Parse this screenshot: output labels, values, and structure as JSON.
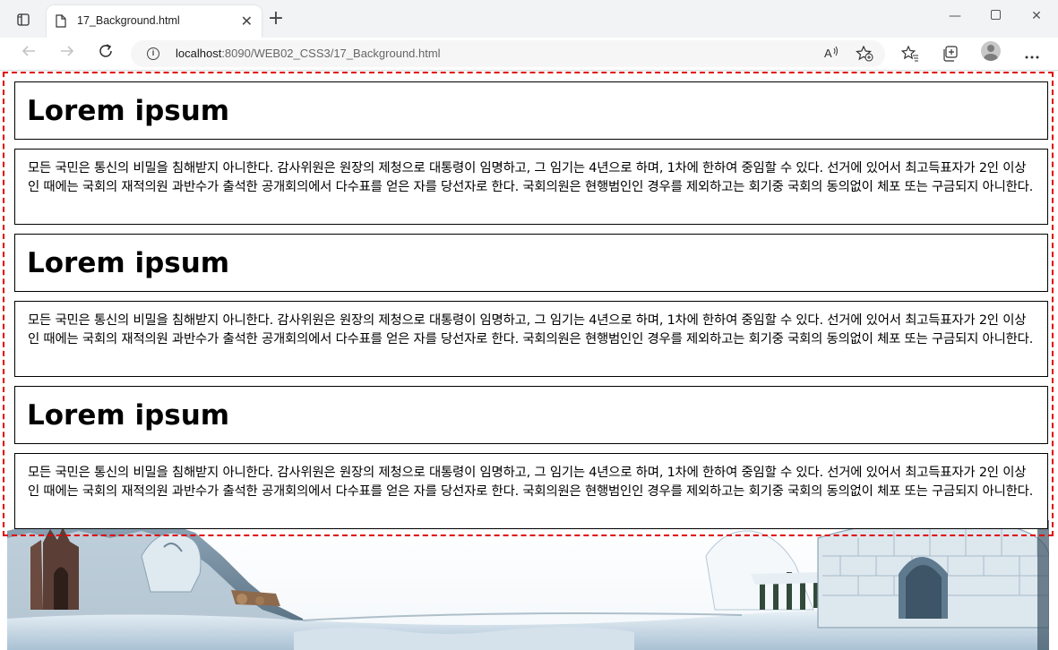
{
  "browser": {
    "tab_title": "17_Background.html",
    "url_host": "localhost",
    "url_rest": ":8090/WEB02_CSS3/17_Background.html"
  },
  "page": {
    "sections": [
      {
        "heading": "Lorem ipsum",
        "text": "모든 국민은 통신의 비밀을 침해받지 아니한다. 감사위원은 원장의 제청으로 대통령이 임명하고, 그 임기는 4년으로 하며, 1차에 한하여 중임할 수 있다. 선거에 있어서 최고득표자가 2인 이상인 때에는 국회의 재적의원 과반수가 출석한 공개회의에서 다수표를 얻은 자를 당선자로 한다. 국회의원은 현행범인인 경우를 제외하고는 회기중 국회의 동의없이 체포 또는 구금되지 아니한다."
      },
      {
        "heading": "Lorem ipsum",
        "text": "모든 국민은 통신의 비밀을 침해받지 아니한다. 감사위원은 원장의 제청으로 대통령이 임명하고, 그 임기는 4년으로 하며, 1차에 한하여 중임할 수 있다. 선거에 있어서 최고득표자가 2인 이상인 때에는 국회의 재적의원 과반수가 출석한 공개회의에서 다수표를 얻은 자를 당선자로 한다. 국회의원은 현행범인인 경우를 제외하고는 회기중 국회의 동의없이 체포 또는 구금되지 아니한다."
      },
      {
        "heading": "Lorem ipsum",
        "text": "모든 국민은 통신의 비밀을 침해받지 아니한다. 감사위원은 원장의 제청으로 대통령이 임명하고, 그 임기는 4년으로 하며, 1차에 한하여 중임할 수 있다. 선거에 있어서 최고득표자가 2인 이상인 때에는 국회의 재적의원 과반수가 출석한 공개회의에서 다수표를 얻은 자를 당선자로 한다. 국회의원은 현행범인인 경우를 제외하고는 회기중 국회의 동의없이 체포 또는 구금되지 아니한다."
      }
    ]
  },
  "icons": {
    "sidebar": "sidebar-toggle-icon",
    "tab_favicon": "page-icon",
    "tab_close": "close-icon",
    "new_tab": "plus-icon",
    "minimize": "minimize-icon",
    "maximize": "maximize-icon",
    "close_window": "close-window-icon",
    "back": "back-arrow-icon",
    "forward": "forward-arrow-icon",
    "refresh": "refresh-icon",
    "site_info": "info-icon",
    "read_aloud": "read-aloud-icon",
    "add_favorite": "star-plus-icon",
    "favorites": "favorites-icon",
    "collections": "collections-icon",
    "profile": "profile-avatar",
    "more": "more-icon"
  },
  "colors": {
    "wrapper_border": "#e00000",
    "box_border": "#000000",
    "chrome_bg": "#f1f3f4"
  }
}
